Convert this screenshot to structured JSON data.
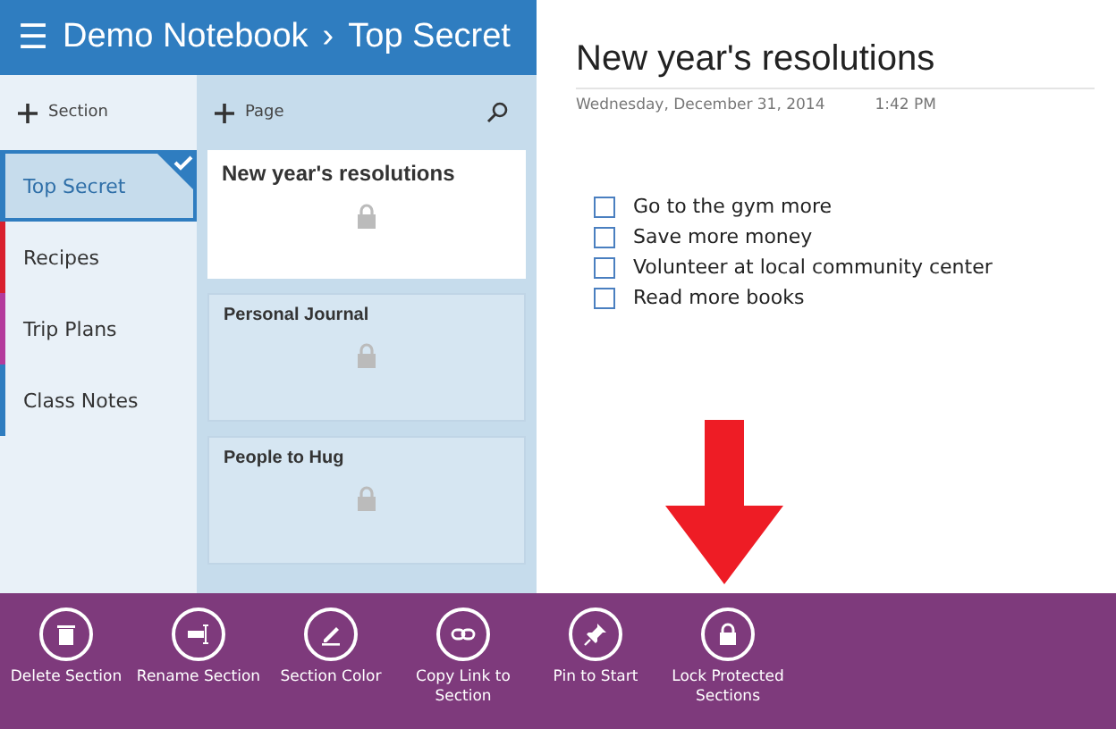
{
  "header": {
    "menu_glyph": "☰",
    "notebook": "Demo Notebook",
    "separator": "›",
    "section": "Top Secret"
  },
  "sections_toolbar": {
    "add_label": "Section"
  },
  "sections": [
    {
      "name": "Top Secret",
      "selected": true,
      "color": "#2f7dc0"
    },
    {
      "name": "Recipes",
      "selected": false,
      "color": "#d9202e"
    },
    {
      "name": "Trip Plans",
      "selected": false,
      "color": "#b43b9c"
    },
    {
      "name": "Class Notes",
      "selected": false,
      "color": "#2f7dc0"
    }
  ],
  "pages_toolbar": {
    "add_label": "Page"
  },
  "pages": [
    {
      "title": "New year's resolutions",
      "selected": true,
      "locked": true
    },
    {
      "title": "Personal Journal",
      "selected": false,
      "locked": true
    },
    {
      "title": "People to Hug",
      "selected": false,
      "locked": true
    }
  ],
  "note": {
    "title": "New year's resolutions",
    "date": "Wednesday, December 31, 2014",
    "time": "1:42 PM",
    "todos": [
      {
        "text": "Go to the gym more",
        "checked": false
      },
      {
        "text": "Save more money",
        "checked": false
      },
      {
        "text": "Volunteer at local community center",
        "checked": false
      },
      {
        "text": "Read more books",
        "checked": false
      }
    ]
  },
  "app_bar": [
    {
      "kind": "trash",
      "label": "Delete Section"
    },
    {
      "kind": "rename",
      "label": "Rename Section"
    },
    {
      "kind": "pen",
      "label": "Section Color"
    },
    {
      "kind": "link",
      "label": "Copy Link to Section"
    },
    {
      "kind": "pin",
      "label": "Pin to Start"
    },
    {
      "kind": "lock",
      "label": "Lock Protected Sections"
    }
  ]
}
